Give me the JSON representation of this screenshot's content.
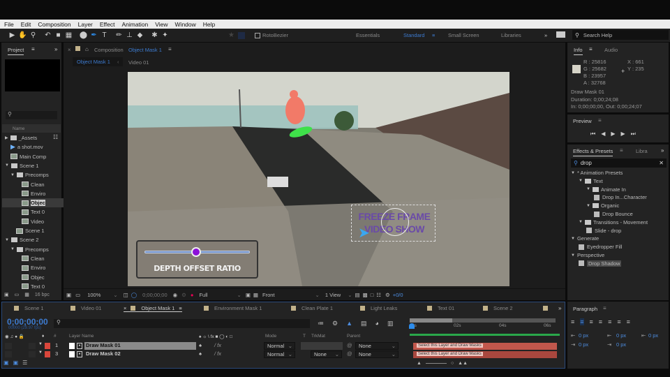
{
  "menu": [
    "File",
    "Edit",
    "Composition",
    "Layer",
    "Effect",
    "Animation",
    "View",
    "Window",
    "Help"
  ],
  "toolbar": {
    "rotobezier_label": "RotoBezier",
    "workspaces": [
      "Essentials",
      "Standard",
      "Small Screen",
      "Libraries"
    ],
    "active_workspace": "Standard",
    "search_help_placeholder": "Search Help"
  },
  "project": {
    "tab": "Project",
    "name_header": "Name",
    "bpc": "16 bpc",
    "items": [
      {
        "label": "_Assets",
        "type": "folder",
        "indent": 0,
        "expanded": false
      },
      {
        "label": "a shot.mov",
        "type": "footage",
        "indent": 1
      },
      {
        "label": "Main Comp",
        "type": "comp",
        "indent": 1
      },
      {
        "label": "Scene 1",
        "type": "folder",
        "indent": 0,
        "expanded": true
      },
      {
        "label": "Precomps",
        "type": "folder",
        "indent": 1,
        "expanded": true
      },
      {
        "label": "Clean",
        "type": "comp",
        "indent": 3
      },
      {
        "label": "Enviro",
        "type": "comp",
        "indent": 3
      },
      {
        "label": "Objec",
        "type": "comp",
        "indent": 3,
        "selected": true
      },
      {
        "label": "Text 0",
        "type": "comp",
        "indent": 3
      },
      {
        "label": "Video",
        "type": "comp",
        "indent": 3
      },
      {
        "label": "Scene 1",
        "type": "comp",
        "indent": 2
      },
      {
        "label": "Scene 2",
        "type": "folder",
        "indent": 0,
        "expanded": true
      },
      {
        "label": "Precomps",
        "type": "folder",
        "indent": 1,
        "expanded": true
      },
      {
        "label": "Clean",
        "type": "comp",
        "indent": 3
      },
      {
        "label": "Enviro",
        "type": "comp",
        "indent": 3
      },
      {
        "label": "Objec",
        "type": "comp",
        "indent": 3
      },
      {
        "label": "Text 0",
        "type": "comp",
        "indent": 3
      }
    ]
  },
  "composition": {
    "panel_label": "Composition",
    "comp_name": "Object Mask 1",
    "breadcrumbs": [
      "Object Mask 1",
      "Video 01"
    ],
    "overlay": {
      "slider_label": "DEPTH OFFSET RATIO",
      "slider_value": 0.49,
      "title_line1": "FREEZE FRAME",
      "title_line2": "VIDEO SHOW"
    },
    "footer": {
      "zoom": "100%",
      "timecode": "0;00;00;00",
      "resolution": "Full",
      "view": "Front",
      "layout": "1 View",
      "exposure": "+0/0"
    }
  },
  "info": {
    "tabs": [
      "Info",
      "Audio"
    ],
    "r": "R : 25816",
    "g": "G : 25682",
    "b": "B : 23957",
    "a": "A : 32768",
    "x": "X : 661",
    "y": "Y : 235",
    "layer": "Draw Mask 01",
    "duration": "Duration: 0;00;24;08",
    "inout": "In: 0;00;00;00, Out: 0;00;24;07",
    "swatch_color": "#d6d4c8"
  },
  "preview": {
    "title": "Preview"
  },
  "effects": {
    "tabs": [
      "Effects & Presets",
      "Libra"
    ],
    "search_value": "drop",
    "rows": [
      {
        "label": "* Animation Presets",
        "indent": 0,
        "kind": "cat"
      },
      {
        "label": "Text",
        "indent": 1,
        "kind": "folder"
      },
      {
        "label": "Animate In",
        "indent": 2,
        "kind": "folder"
      },
      {
        "label": "Drop In...Character",
        "indent": 3,
        "kind": "preset"
      },
      {
        "label": "Organic",
        "indent": 2,
        "kind": "folder"
      },
      {
        "label": "Drop Bounce",
        "indent": 3,
        "kind": "preset"
      },
      {
        "label": "Transitions - Movement",
        "indent": 1,
        "kind": "folder"
      },
      {
        "label": "Slide - drop",
        "indent": 2,
        "kind": "preset"
      },
      {
        "label": "Generate",
        "indent": 0,
        "kind": "cat"
      },
      {
        "label": "Eyedropper Fill",
        "indent": 1,
        "kind": "effect"
      },
      {
        "label": "Perspective",
        "indent": 0,
        "kind": "cat"
      },
      {
        "label": "Drop Shadow",
        "indent": 1,
        "kind": "effect",
        "selected": true
      }
    ]
  },
  "timeline": {
    "tabs": [
      "Scene 1",
      "Video 01",
      "Object Mask 1",
      "Environment Mask 1",
      "Clean Plate 1",
      "Light Leaks",
      "Text 01",
      "Scene 2"
    ],
    "active_tab": "Object Mask 1",
    "timecode": "0;00;00;00",
    "frame_info": "00000 (29.97 fps)",
    "columns": {
      "layer_name": "Layer Name",
      "mode": "Mode",
      "t": "T",
      "trkmat": "TrkMat",
      "parent": "Parent"
    },
    "ruler": [
      "0s",
      "02s",
      "04s",
      "06s"
    ],
    "work_area_end_fraction": 0.29,
    "layers": [
      {
        "num": "1",
        "name": "Draw Mask 01",
        "mode": "Normal",
        "trkmat": "",
        "parent": "None",
        "bar_label": "Select this Layer and Draw Masks",
        "selected": true
      },
      {
        "num": "3",
        "name": "Draw Mask 02",
        "mode": "Normal",
        "trkmat": "None",
        "parent": "None",
        "bar_label": "Select this Layer and Draw Masks",
        "selected": false
      }
    ]
  },
  "paragraph": {
    "title": "Paragraph",
    "fields": [
      "0 px",
      "0 px",
      "0 px",
      "0 px",
      "0 px"
    ]
  }
}
